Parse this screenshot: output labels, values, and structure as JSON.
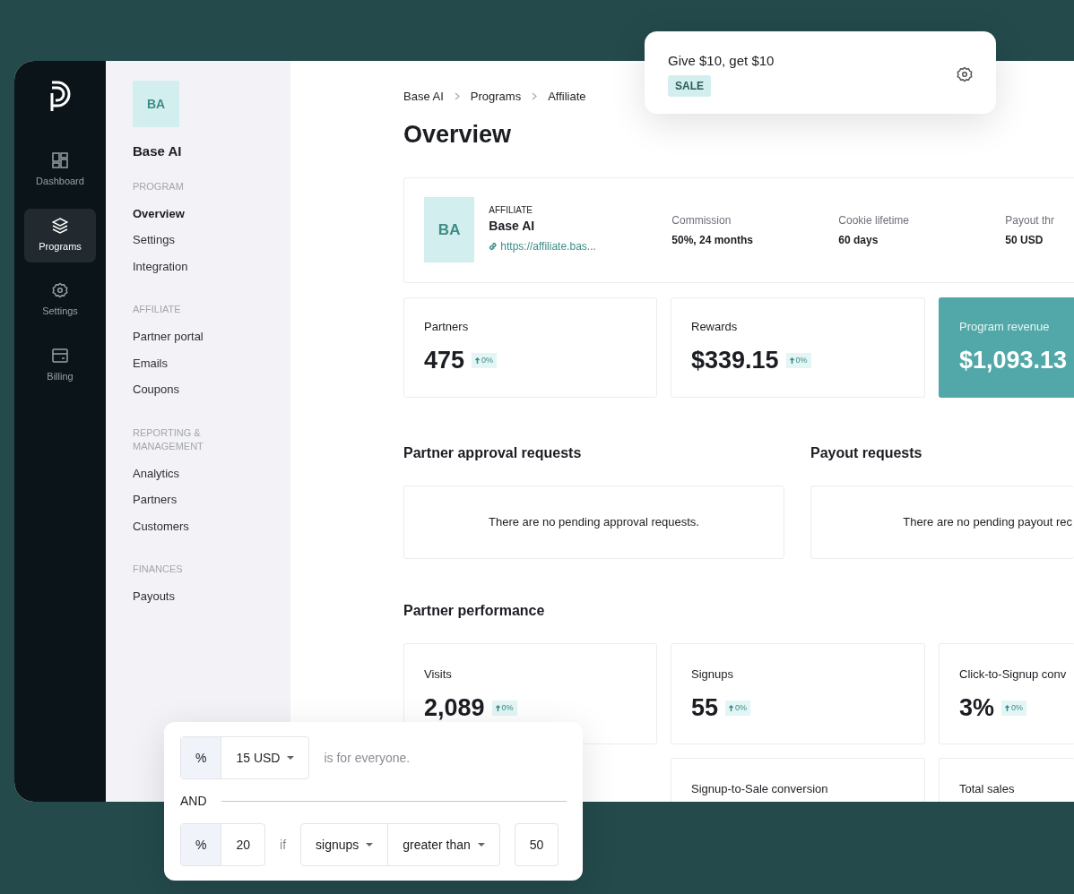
{
  "rail": [
    {
      "label": "Dashboard",
      "selected": false
    },
    {
      "label": "Programs",
      "selected": true
    },
    {
      "label": "Settings",
      "selected": false
    },
    {
      "label": "Billing",
      "selected": false
    }
  ],
  "sidebar": {
    "avatar": "BA",
    "name": "Base AI",
    "sections": [
      {
        "title": "PROGRAM",
        "items": [
          {
            "label": "Overview",
            "selected": true
          },
          {
            "label": "Settings",
            "selected": false
          },
          {
            "label": "Integration",
            "selected": false
          }
        ]
      },
      {
        "title": "AFFILIATE",
        "items": [
          {
            "label": "Partner portal",
            "selected": false
          },
          {
            "label": "Emails",
            "selected": false
          },
          {
            "label": "Coupons",
            "selected": false
          }
        ]
      },
      {
        "title": "REPORTING & MANAGEMENT",
        "items": [
          {
            "label": "Analytics",
            "selected": false
          },
          {
            "label": "Partners",
            "selected": false
          },
          {
            "label": "Customers",
            "selected": false
          }
        ]
      },
      {
        "title": "FINANCES",
        "items": [
          {
            "label": "Payouts",
            "selected": false
          }
        ]
      }
    ]
  },
  "breadcrumb": [
    "Base AI",
    "Programs",
    "Affiliate"
  ],
  "page_title": "Overview",
  "program": {
    "avatar": "BA",
    "type": "AFFILIATE",
    "name": "Base AI",
    "url": "https://affiliate.bas...",
    "facts": [
      {
        "label": "Commission",
        "value": "50%, 24 months"
      },
      {
        "label": "Cookie lifetime",
        "value": "60 days"
      },
      {
        "label": "Payout thr",
        "value": "50 USD"
      }
    ]
  },
  "stats": [
    {
      "label": "Partners",
      "value": "475",
      "change": "0%",
      "highlight": false
    },
    {
      "label": "Rewards",
      "value": "$339.15",
      "change": "0%",
      "highlight": false
    },
    {
      "label": "Program revenue",
      "value": "$1,093.13",
      "highlight": true
    }
  ],
  "requests": [
    {
      "title": "Partner approval requests",
      "empty": "There are no pending approval requests."
    },
    {
      "title": "Payout requests",
      "empty": "There are no pending payout rec"
    }
  ],
  "performance": {
    "title": "Partner performance",
    "cards": [
      {
        "label": "Visits",
        "value": "2,089",
        "change": "0%"
      },
      {
        "label": "Signups",
        "value": "55",
        "change": "0%"
      },
      {
        "label": "Click-to-Signup conv",
        "value": "3%",
        "change": "0%"
      },
      {
        "label": "Signup-to-Sale conversion"
      },
      {
        "label": "Total sales"
      }
    ]
  },
  "offer_popup": {
    "title": "Give $10, get $10",
    "tag": "SALE"
  },
  "rule_popup": {
    "rows": [
      {
        "kind": "base",
        "unit": "%",
        "amount": "15 USD",
        "note": "is for everyone."
      },
      {
        "kind": "divider",
        "label": "AND"
      },
      {
        "kind": "conditional",
        "unit": "%",
        "amount": "20",
        "if": "if",
        "metric": "signups",
        "operator": "greater than",
        "threshold": "50"
      }
    ]
  }
}
